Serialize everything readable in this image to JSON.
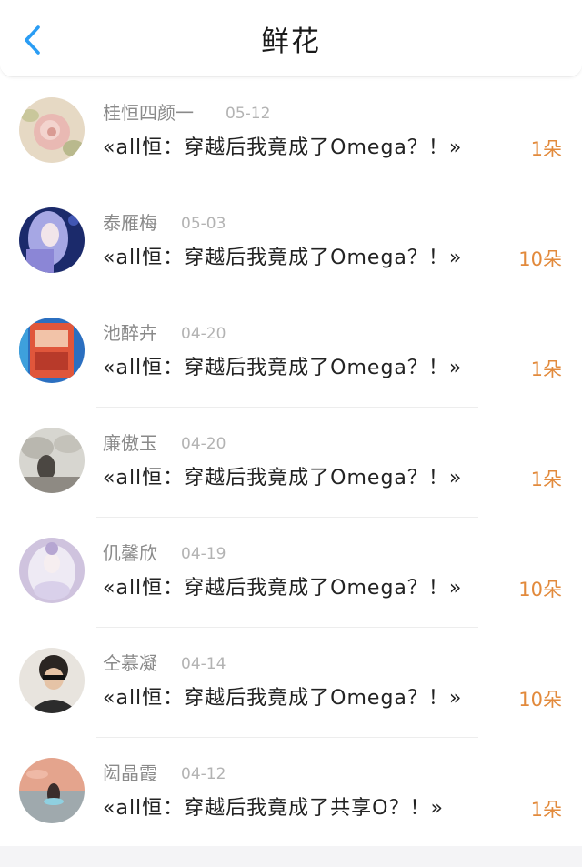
{
  "header": {
    "title": "鲜花",
    "back_icon": "chevron-left-icon"
  },
  "colors": {
    "accent": "#2a9df4",
    "quantity": "#e28a3c",
    "name": "#8a8a8a",
    "date": "#b3b3b3"
  },
  "items": [
    {
      "name": "桂恒四颜一",
      "date": "05-12",
      "book": "«all恒：穿越后我竟成了Omega？！»",
      "qty": "1朵"
    },
    {
      "name": "泰雁梅",
      "date": "05-03",
      "book": "«all恒：穿越后我竟成了Omega？！»",
      "qty": "10朵"
    },
    {
      "name": "池醉卉",
      "date": "04-20",
      "book": "«all恒：穿越后我竟成了Omega？！»",
      "qty": "1朵"
    },
    {
      "name": "廉傲玉",
      "date": "04-20",
      "book": "«all恒：穿越后我竟成了Omega？！»",
      "qty": "1朵"
    },
    {
      "name": "仉馨欣",
      "date": "04-19",
      "book": "«all恒：穿越后我竟成了Omega？！»",
      "qty": "10朵"
    },
    {
      "name": "仝慕凝",
      "date": "04-14",
      "book": "«all恒：穿越后我竟成了Omega？！»",
      "qty": "10朵"
    },
    {
      "name": "闳晶霞",
      "date": "04-12",
      "book": "«all恒：穿越后我竟成了共享O？！»",
      "qty": "1朵"
    }
  ]
}
